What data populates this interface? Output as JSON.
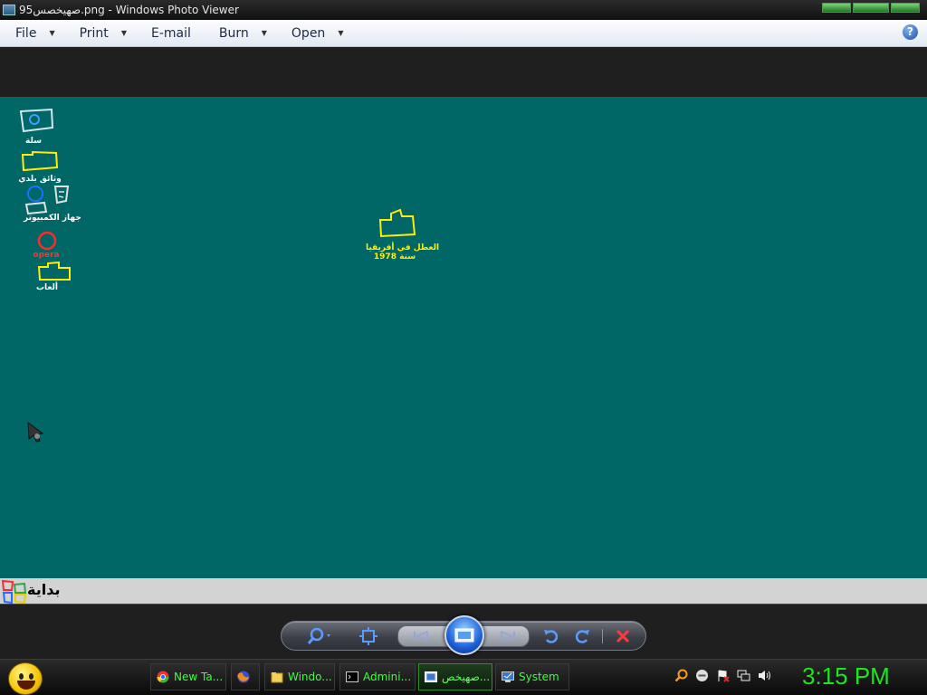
{
  "window": {
    "title": "صهيخصس95.png - Windows Photo Viewer"
  },
  "menu": {
    "file": "File",
    "print": "Print",
    "email": "E-mail",
    "burn": "Burn",
    "open": "Open",
    "help": "?"
  },
  "photo": {
    "icons": [
      {
        "label": "سلة"
      },
      {
        "label": "وثائق بلدي"
      },
      {
        "label": "جهاز الكمبيوتر"
      },
      {
        "label": "opera"
      },
      {
        "label": "ألعاب"
      },
      {
        "label_line1": "العطل في أفريقيا",
        "label_line2": "سنة 1978"
      }
    ],
    "start_label": "بداية"
  },
  "taskbar": {
    "tasks": [
      {
        "label": "New Ta..."
      },
      {
        "label": "Windo..."
      },
      {
        "label": "Admini..."
      },
      {
        "label": "صهيخص..."
      },
      {
        "label": "System"
      }
    ],
    "clock": "3:15 PM"
  },
  "colors": {
    "desktop": "#006666",
    "taskbar_text": "#3cff3c",
    "clock": "#1ee51e",
    "icon_yellow": "#ffee00"
  }
}
